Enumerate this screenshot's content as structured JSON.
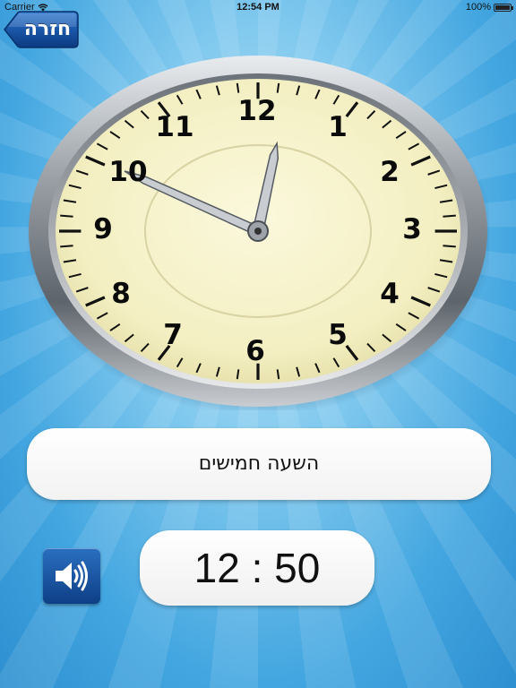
{
  "status_bar": {
    "carrier": "Carrier",
    "time": "12:54 PM",
    "battery": "100%"
  },
  "nav": {
    "back_label": "חזרה"
  },
  "clock": {
    "numerals": {
      "n12": "12",
      "n1": "1",
      "n2": "2",
      "n3": "3",
      "n4": "4",
      "n5": "5",
      "n6": "6",
      "n7": "7",
      "n8": "8",
      "n9": "9",
      "n10": "10",
      "n11": "11"
    },
    "hour": 12,
    "minute": 50,
    "face_color": "#f6f2c8",
    "rim_color": "#8a8f96"
  },
  "phrase": {
    "text": "השעה חמישים"
  },
  "digital_time": {
    "text": "12 : 50"
  },
  "colors": {
    "background": "#43a6e0",
    "button_blue": "#0e3f86"
  }
}
